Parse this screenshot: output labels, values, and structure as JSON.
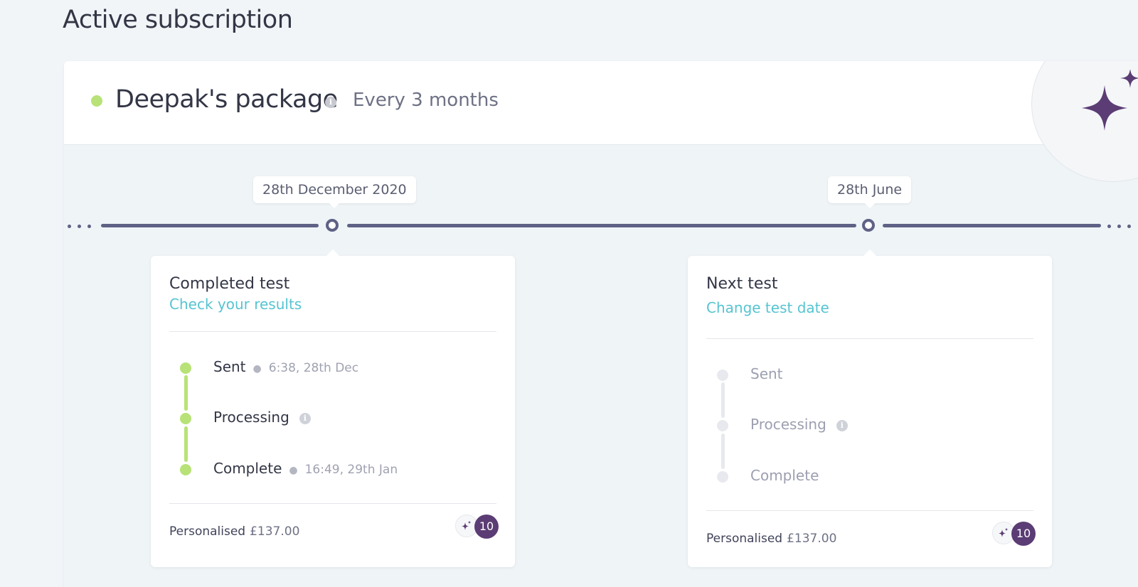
{
  "page": {
    "title": "Active subscription"
  },
  "package": {
    "name": "Deepak's package",
    "frequency": "Every 3 months",
    "info_icon": "info-icon",
    "status_color": "#b8e277",
    "badge_icon": "sparkle-icon"
  },
  "timeline": {
    "dates": [
      "28th December 2020",
      "28th June"
    ]
  },
  "cards": [
    {
      "title": "Completed test",
      "link": "Check your results",
      "state": "done",
      "steps": [
        {
          "label": "Sent",
          "time": "6:38, 28th Dec"
        },
        {
          "label": "Processing",
          "info": true
        },
        {
          "label": "Complete",
          "time": "16:49, 29th Jan"
        }
      ],
      "plan": "Personalised",
      "price": "£137.00",
      "tokens": "10"
    },
    {
      "title": "Next test",
      "link": "Change test date",
      "state": "pending",
      "steps": [
        {
          "label": "Sent"
        },
        {
          "label": "Processing",
          "info": true
        },
        {
          "label": "Complete"
        }
      ],
      "plan": "Personalised",
      "price": "£137.00",
      "tokens": "10"
    }
  ],
  "colors": {
    "accent_link": "#56c4d1",
    "timeline": "#5f6185",
    "done": "#b8e277",
    "pending": "#e8e9ee",
    "brand_purple": "#5b3c74"
  }
}
